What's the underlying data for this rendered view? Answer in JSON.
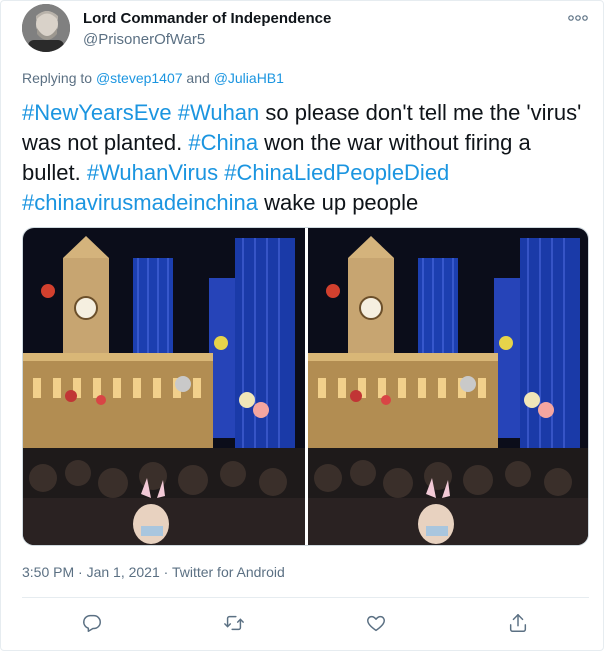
{
  "tweet": {
    "author_name": "Lord Commander of Independence",
    "author_handle": "@PrisonerOfWar5",
    "reply_prefix": "Replying to ",
    "reply_to_1": "@stevep1407",
    "reply_and": " and ",
    "reply_to_2": "@JuliaHB1",
    "text_segments": [
      {
        "t": "#NewYearsEve",
        "tag": true
      },
      {
        "t": " ",
        "tag": false
      },
      {
        "t": "#Wuhan",
        "tag": true
      },
      {
        "t": " so please don't tell me the 'virus' was not planted.  ",
        "tag": false
      },
      {
        "t": "#China",
        "tag": true
      },
      {
        "t": " won the war without firing a bullet. ",
        "tag": false
      },
      {
        "t": "#WuhanVirus",
        "tag": true
      },
      {
        "t": " ",
        "tag": false
      },
      {
        "t": "#ChinaLiedPeopleDied",
        "tag": true
      },
      {
        "t": " ",
        "tag": false
      },
      {
        "t": "#chinavirusmadeinchina",
        "tag": true
      },
      {
        "t": " wake up people",
        "tag": false
      }
    ],
    "timestamp": "3:50 PM · Jan 1, 2021 · Twitter for Android"
  },
  "colors": {
    "link": "#1b95e0",
    "muted": "#5b7083",
    "text": "#0f1419"
  },
  "icons": [
    "more-icon",
    "reply-icon",
    "retweet-icon",
    "like-icon",
    "share-icon"
  ]
}
